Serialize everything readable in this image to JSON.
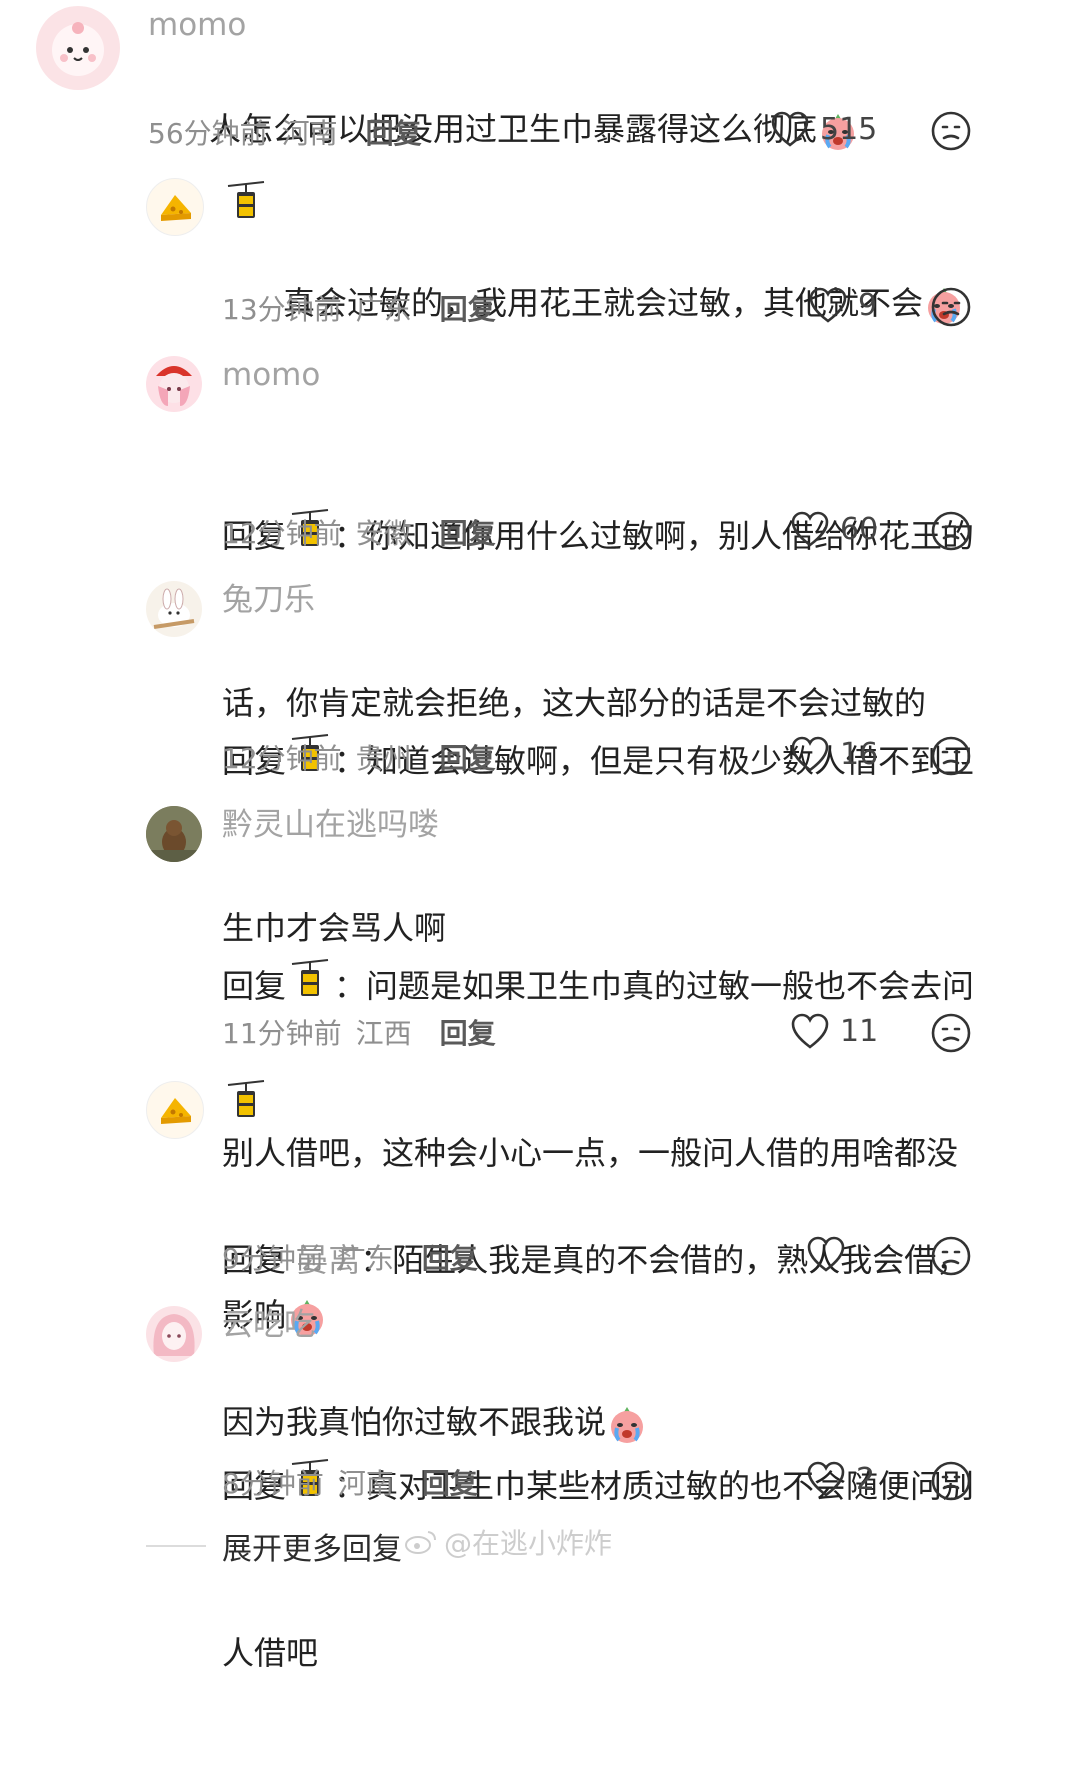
{
  "comments": [
    {
      "author": "momo",
      "text": "人怎么可以把没用过卫生巾暴露得这么彻底",
      "time": "56分钟前",
      "region": "河南",
      "reply_label": "回复",
      "likes": "515"
    },
    {
      "author_icon": "cable-car-icon",
      "text": "真会过敏的，我用花王就会过敏，其他就不会",
      "time": "13分钟前",
      "region": "广东",
      "reply_label": "回复",
      "likes": "9"
    },
    {
      "author": "momo",
      "reply_prefix": "回复",
      "text1": "：你知道你用什么过敏啊，别人借给你花王的",
      "text2": "话，你肯定就会拒绝，这大部分的话是不会过敏的",
      "time": "12分钟前",
      "region": "安徽",
      "reply_label": "回复",
      "likes": "60"
    },
    {
      "author": "兔刀乐",
      "reply_prefix": "回复",
      "text1": "：知道会过敏啊，但是只有极少数人借不到卫",
      "text2": "生巾才会骂人啊",
      "time": "12分钟前",
      "region": "贵州",
      "reply_label": "回复",
      "likes": "16"
    },
    {
      "author": "黔灵山在逃吗喽",
      "reply_prefix": "回复",
      "text1": "：问题是如果卫生巾真的过敏一般也不会去问",
      "text2": "别人借吧，这种会小心一点，一般问人借的用啥都没",
      "text3": "影响",
      "time": "11分钟前",
      "region": "江西",
      "reply_label": "回复",
      "likes": "11"
    },
    {
      "author_icon": "cable-car-icon",
      "reply_prefix": "回复",
      "reply_to": "晏离",
      "text1": "：陌生人我是真的不会借的，熟人我会借，",
      "text2": "因为我真怕你过敏不跟我说",
      "time": "9分钟前",
      "region": "广东",
      "reply_label": "回复",
      "likes": ""
    },
    {
      "author": "云吃吃",
      "reply_prefix": "回复",
      "text1": "：真对卫生巾某些材质过敏的也不会随便问别",
      "text2": "人借吧",
      "time": "8分钟前",
      "region": "河南",
      "reply_label": "回复",
      "likes": "2"
    }
  ],
  "expand_more": "展开更多回复",
  "watermark": "@在逃小炸炸",
  "icons": [
    "heart-icon",
    "dislike-face-icon",
    "crying-emoji-icon",
    "cable-car-icon"
  ],
  "colors": {
    "meta_gray": "#8f8f8f",
    "author_gray": "#a3a3a3",
    "text": "#222222"
  }
}
